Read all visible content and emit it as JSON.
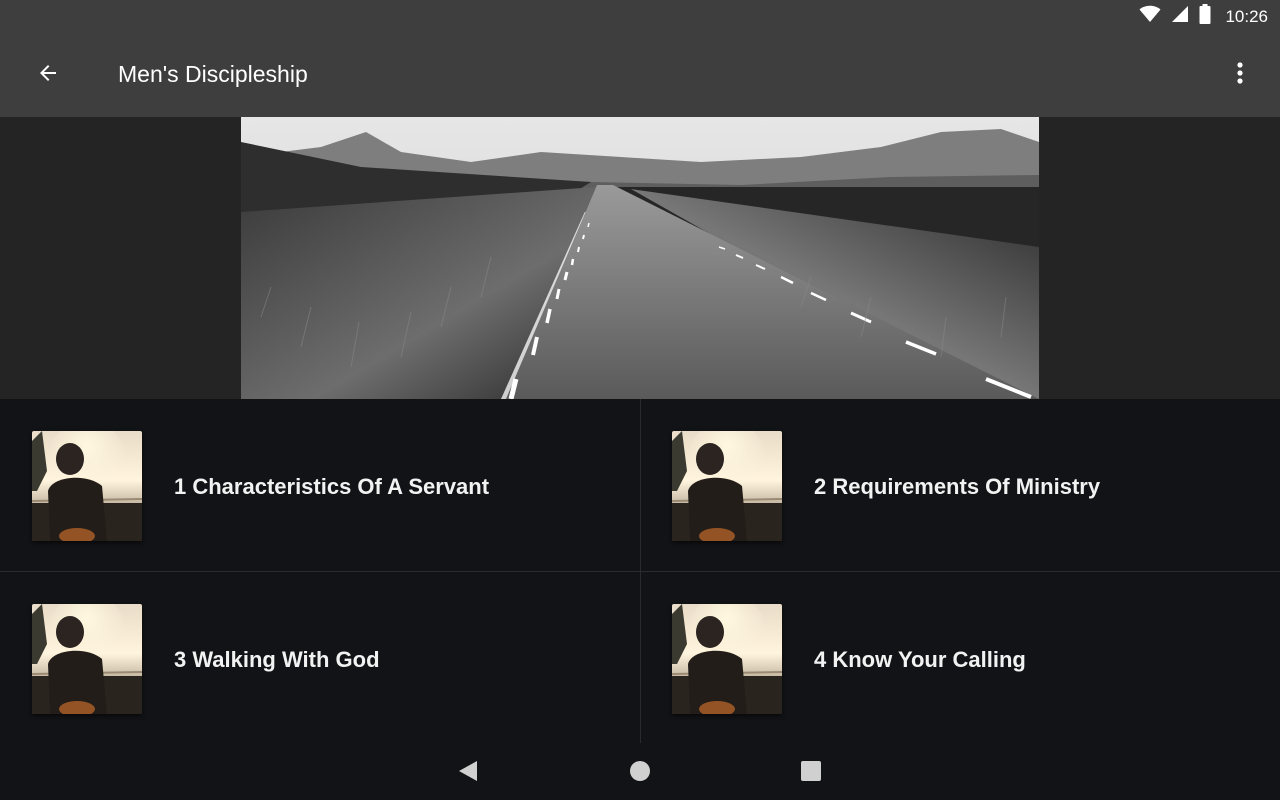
{
  "status_bar": {
    "time": "10:26",
    "icons": [
      "wifi-icon",
      "cell-signal-icon",
      "battery-icon"
    ]
  },
  "app_bar": {
    "title": "Men's Discipleship",
    "back_icon": "arrow-back-icon",
    "menu_icon": "more-vertical-icon"
  },
  "hero": {
    "image": "road-landscape-bw"
  },
  "lessons": [
    {
      "label": "1 Characteristics Of A Servant"
    },
    {
      "label": "2 Requirements Of Ministry"
    },
    {
      "label": "3 Walking With God"
    },
    {
      "label": "4 Know Your Calling"
    }
  ],
  "nav_bar": {
    "icons": [
      "nav-back-icon",
      "nav-home-icon",
      "nav-recents-icon"
    ]
  },
  "colors": {
    "app_bar": "#3e3e3e",
    "background": "#121316",
    "hero_background": "#242424"
  }
}
